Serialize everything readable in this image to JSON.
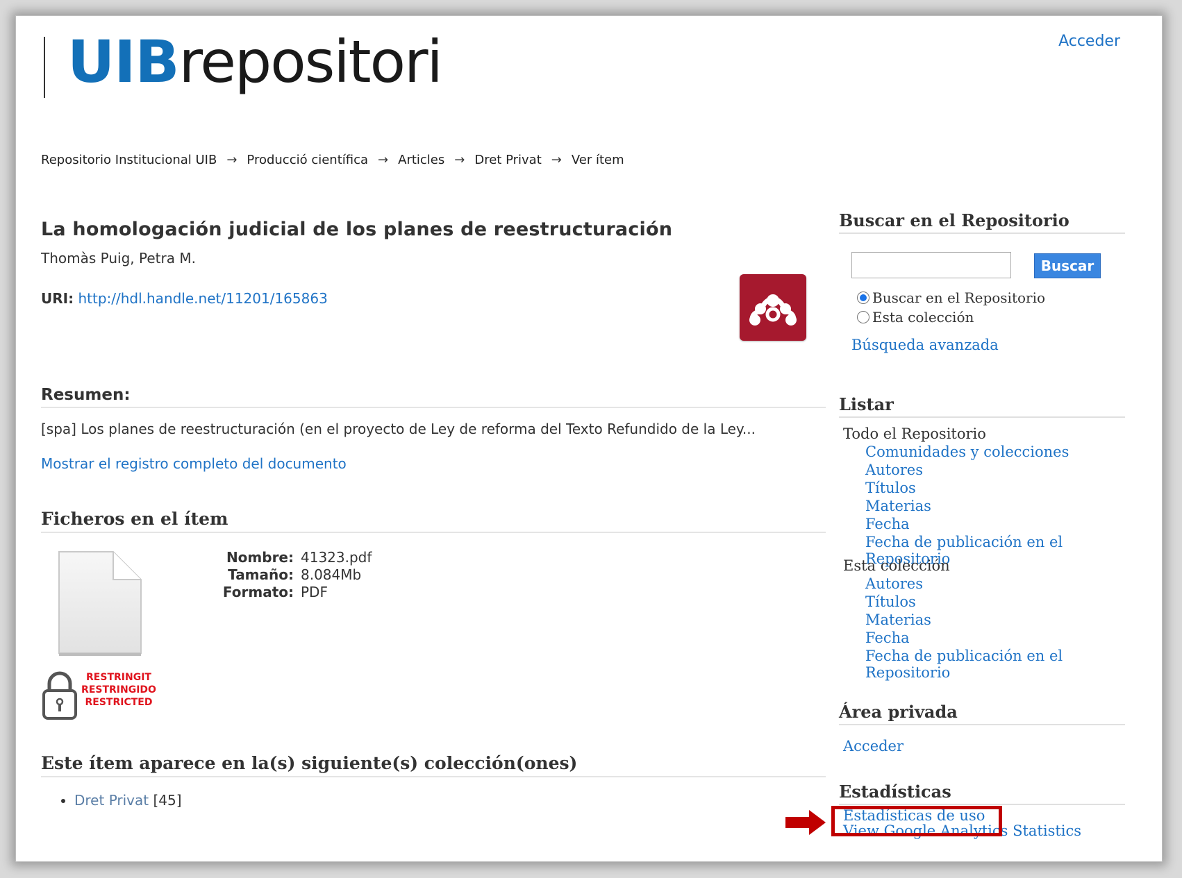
{
  "header": {
    "login_link": "Acceder",
    "logo_uib": "UIB",
    "logo_repositori": "repositori"
  },
  "breadcrumb": [
    "Repositorio Institucional UIB",
    "Producció científica",
    "Articles",
    "Dret Privat",
    "Ver ítem"
  ],
  "breadcrumb_separator": "→",
  "item": {
    "title": "La homologación judicial de los planes de reestructuración",
    "authors": "Thomàs Puig, Petra M.",
    "uri_label": "URI:",
    "uri": "http://hdl.handle.net/11201/165863",
    "resumen_heading": "Resumen:",
    "resumen_text": "[spa] Los planes de reestructuración (en el proyecto de Ley de reforma del Texto Refundido de la Ley...",
    "mostrar_link": "Mostrar el registro completo del documento"
  },
  "files": {
    "heading": "Ficheros en el ítem",
    "name_label": "Nombre:",
    "name": "41323.pdf",
    "size_label": "Tamaño:",
    "size": "8.084Mb",
    "format_label": "Formato:",
    "format": "PDF",
    "restricted_lines": [
      "RESTRINGIT",
      "RESTRINGIDO",
      "RESTRICTED"
    ]
  },
  "collections": {
    "heading": "Este ítem aparece en la(s) siguiente(s) colección(ones)",
    "items": [
      {
        "name": "Dret Privat",
        "count": "[45]"
      }
    ]
  },
  "sidebar": {
    "search": {
      "heading": "Buscar en el Repositorio",
      "button": "Buscar",
      "radio_repo": "Buscar en el Repositorio",
      "radio_collection": "Esta colección",
      "advanced": "Búsqueda avanzada"
    },
    "listar": {
      "heading": "Listar",
      "group1_title": "Todo el Repositorio",
      "group1": [
        "Comunidades y colecciones",
        "Autores",
        "Títulos",
        "Materias",
        "Fecha",
        "Fecha de publicación en el Repositorio"
      ],
      "group2_title": "Esta colección",
      "group2": [
        "Autores",
        "Títulos",
        "Materias",
        "Fecha",
        "Fecha de publicación en el Repositorio"
      ]
    },
    "private": {
      "heading": "Área privada",
      "login": "Acceder"
    },
    "stats": {
      "heading": "Estadísticas",
      "usage": "Estadísticas de uso",
      "google": "View Google Analytics Statistics"
    }
  },
  "colors": {
    "link": "#1f73c6",
    "logo_blue": "#1370b8",
    "mendeley_red": "#a6192e",
    "highlight_red": "#c00000",
    "restricted_red": "#e0141e"
  }
}
